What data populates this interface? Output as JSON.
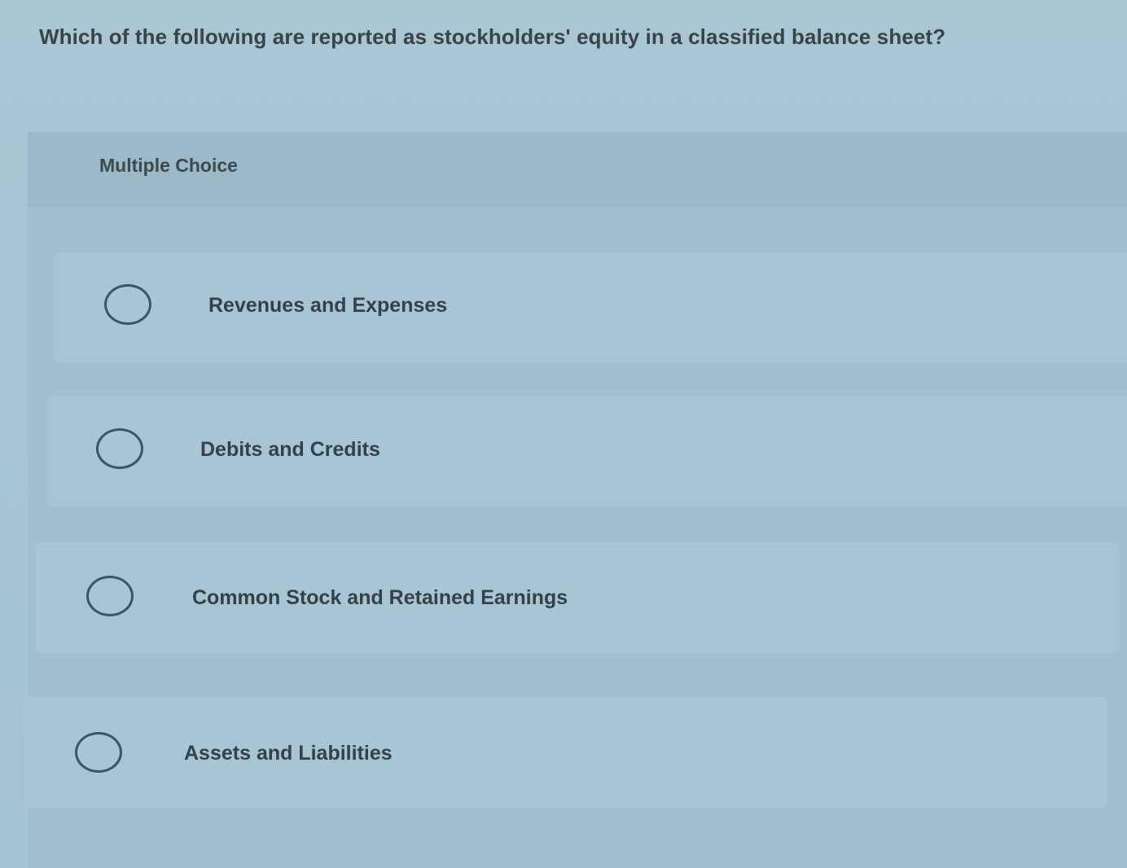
{
  "question": {
    "text": "Which of the following are reported as stockholders' equity in a classified balance sheet?"
  },
  "question_type": "Multiple Choice",
  "options": [
    {
      "label": "Revenues and Expenses",
      "selected": false
    },
    {
      "label": "Debits and Credits",
      "selected": false
    },
    {
      "label": "Common Stock and Retained Earnings",
      "selected": false
    },
    {
      "label": "Assets and Liabilities",
      "selected": false
    }
  ]
}
